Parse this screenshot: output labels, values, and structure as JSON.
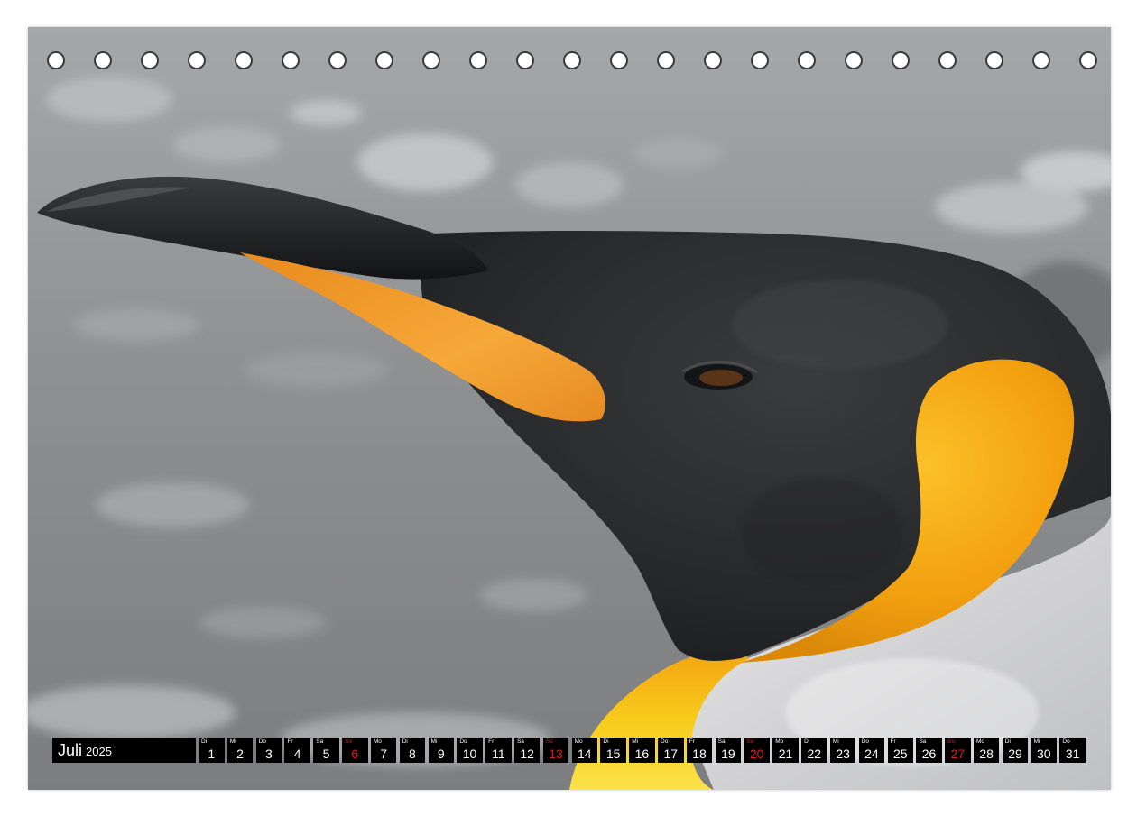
{
  "photo": {
    "subject": "king-penguin-head",
    "colors": {
      "beak_dark": "#1b1c1e",
      "beak_orange": "#f3a030",
      "head_dark": "#2c2d2f",
      "ear_patch": "#f5a415",
      "neck_yellow": "#f7c61a",
      "chest_white": "#d7d7d9",
      "background_gray": "#8c8d8f"
    }
  },
  "calendar": {
    "month": "Juli",
    "year": "2025",
    "sunday_color": "#e0191b",
    "days": [
      {
        "wd": "Di",
        "num": "1",
        "sunday": false
      },
      {
        "wd": "Mi",
        "num": "2",
        "sunday": false
      },
      {
        "wd": "Do",
        "num": "3",
        "sunday": false
      },
      {
        "wd": "Fr",
        "num": "4",
        "sunday": false
      },
      {
        "wd": "Sa",
        "num": "5",
        "sunday": false
      },
      {
        "wd": "So",
        "num": "6",
        "sunday": true
      },
      {
        "wd": "Mo",
        "num": "7",
        "sunday": false
      },
      {
        "wd": "Di",
        "num": "8",
        "sunday": false
      },
      {
        "wd": "Mi",
        "num": "9",
        "sunday": false
      },
      {
        "wd": "Do",
        "num": "10",
        "sunday": false
      },
      {
        "wd": "Fr",
        "num": "11",
        "sunday": false
      },
      {
        "wd": "Sa",
        "num": "12",
        "sunday": false
      },
      {
        "wd": "So",
        "num": "13",
        "sunday": true
      },
      {
        "wd": "Mo",
        "num": "14",
        "sunday": false
      },
      {
        "wd": "Di",
        "num": "15",
        "sunday": false
      },
      {
        "wd": "Mi",
        "num": "16",
        "sunday": false
      },
      {
        "wd": "Do",
        "num": "17",
        "sunday": false
      },
      {
        "wd": "Fr",
        "num": "18",
        "sunday": false
      },
      {
        "wd": "Sa",
        "num": "19",
        "sunday": false
      },
      {
        "wd": "So",
        "num": "20",
        "sunday": true
      },
      {
        "wd": "Mo",
        "num": "21",
        "sunday": false
      },
      {
        "wd": "Di",
        "num": "22",
        "sunday": false
      },
      {
        "wd": "Mi",
        "num": "23",
        "sunday": false
      },
      {
        "wd": "Do",
        "num": "24",
        "sunday": false
      },
      {
        "wd": "Fr",
        "num": "25",
        "sunday": false
      },
      {
        "wd": "Sa",
        "num": "26",
        "sunday": false
      },
      {
        "wd": "So",
        "num": "27",
        "sunday": true
      },
      {
        "wd": "Mo",
        "num": "28",
        "sunday": false
      },
      {
        "wd": "Di",
        "num": "29",
        "sunday": false
      },
      {
        "wd": "Mi",
        "num": "30",
        "sunday": false
      },
      {
        "wd": "Do",
        "num": "31",
        "sunday": false
      }
    ]
  }
}
